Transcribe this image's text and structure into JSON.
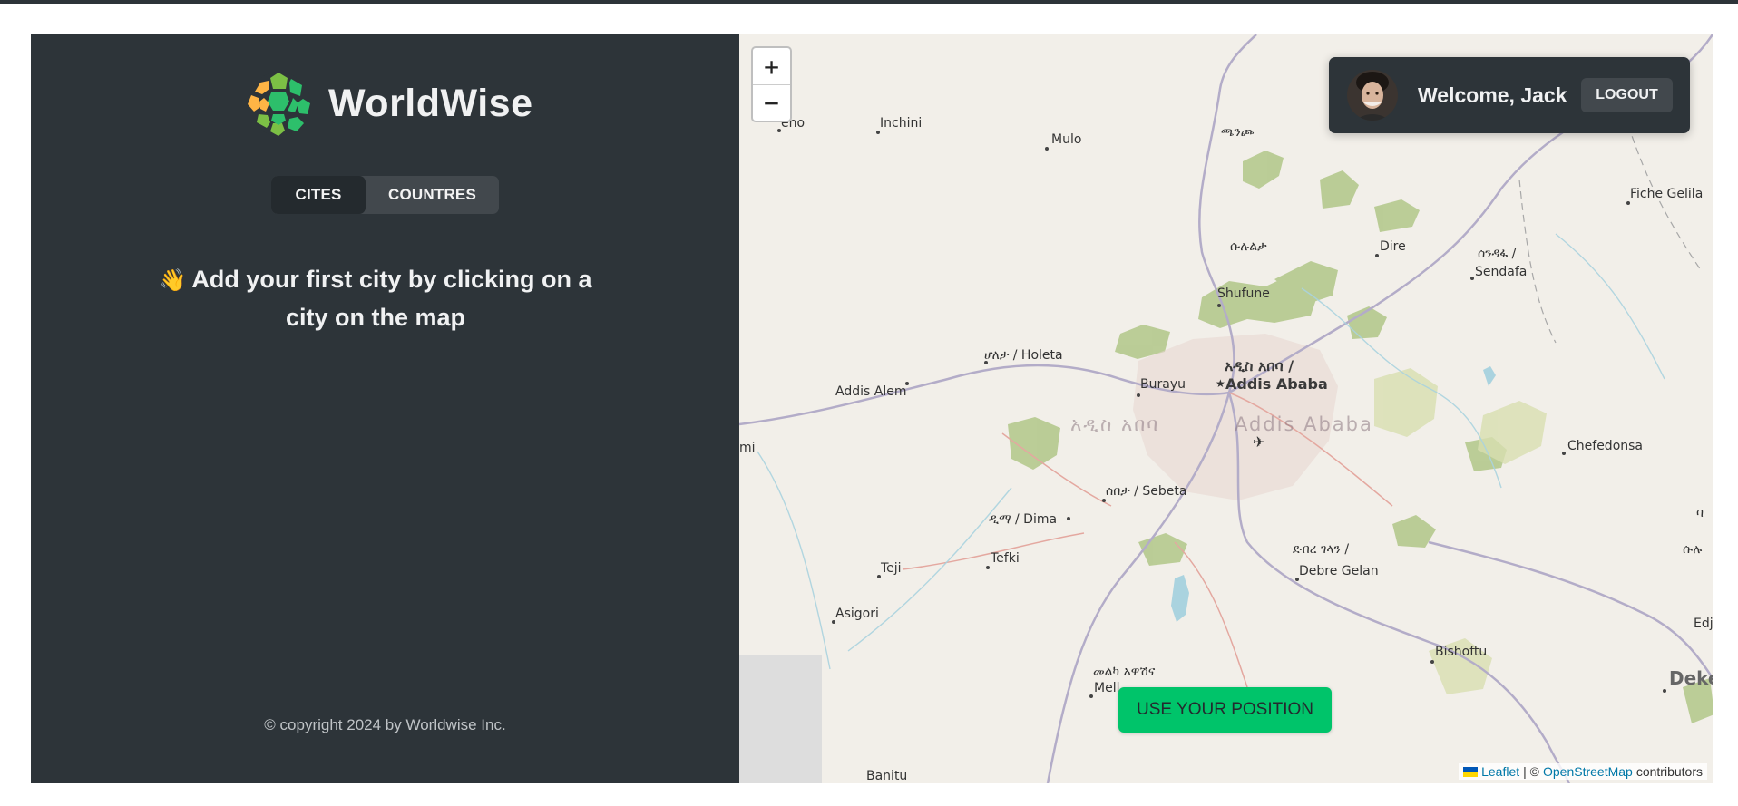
{
  "brand": {
    "name": "WorldWise"
  },
  "tabs": {
    "cities": "CITES",
    "countries": "COUNTRES"
  },
  "empty_state": {
    "emoji": "👋",
    "message": "Add your first city by clicking on a city on the map"
  },
  "footer": {
    "copyright": "© copyright 2024 by Worldwise Inc."
  },
  "user": {
    "welcome": "Welcome, Jack",
    "logout": "LOGOUT"
  },
  "map": {
    "zoom_in": "+",
    "zoom_out": "−",
    "use_position": "USE YOUR POSITION",
    "attribution": {
      "leaflet": "Leaflet",
      "separator": "| ©",
      "osm": "OpenStreetMap",
      "suffix": "contributors"
    },
    "places": [
      "Inchini",
      "Mulo",
      "ጫንጮ",
      "ሱሉልታ",
      "Dire",
      "Fiche Gelila",
      "ሰንዳፋ /",
      "Sendafa",
      "Shufune",
      "ሆለታ / Holeta",
      "አዲስ አበባ /",
      "Addis Ababa",
      "Burayu",
      "Addis Alem",
      "አዲስ አበባ",
      "Addis Ababa",
      "Chefedonsa",
      "ሰበታ / Sebeta",
      "ዲማ / Dima",
      "Tefki",
      "Teji",
      "ደብረ ገላን /",
      "Debre Gelan",
      "Asigori",
      "Bishoftu",
      "Dekeb",
      "መልካ አዋሽና",
      "Mell",
      "Banitu",
      "eno",
      "mi",
      "Edj",
      "ባ",
      "ሱሉ"
    ]
  },
  "colors": {
    "sidebar": "#2d3439",
    "accent": "#00c46a",
    "tab_active": "#242a2e",
    "tab_bar": "#42484d"
  }
}
